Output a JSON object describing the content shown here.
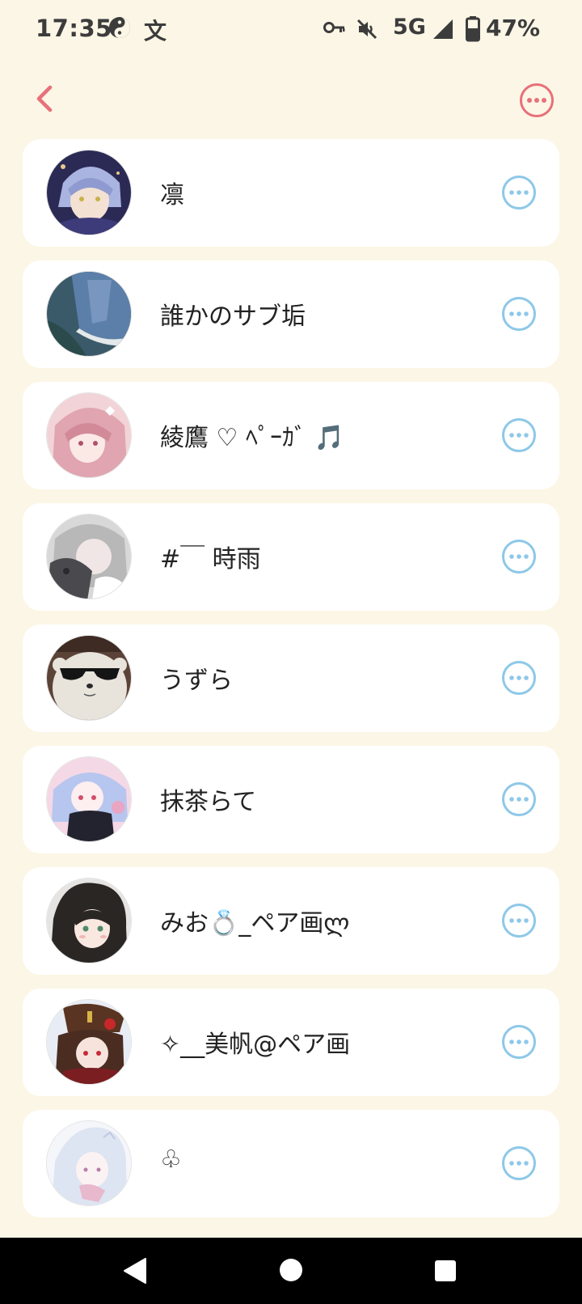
{
  "status_bar": {
    "time": "17:35",
    "lang_glyph": "文",
    "network": "5G",
    "battery": "47%",
    "icons": [
      "yin-yang-icon",
      "key-icon",
      "mute-icon",
      "signal-icon",
      "battery-icon"
    ]
  },
  "header": {
    "back_icon": "chevron-left-icon",
    "more_icon": "more-circle-icon"
  },
  "friends": [
    {
      "name": "凛"
    },
    {
      "name": "誰かのサブ垢"
    },
    {
      "name": "綾鷹 ♡ ﾍﾟｰｶﾞ 🎵"
    },
    {
      "name": "#￣ 時雨"
    },
    {
      "name": "うずら"
    },
    {
      "name": "抹茶らて"
    },
    {
      "name": "みお💍_ペア画ლ"
    },
    {
      "name": "✧__美帆@ペア画"
    },
    {
      "name": "♧"
    }
  ],
  "colors": {
    "background": "#fcf6e6",
    "card": "#ffffff",
    "accent_pink": "#e8707a",
    "accent_blue": "#8ec8e8"
  }
}
